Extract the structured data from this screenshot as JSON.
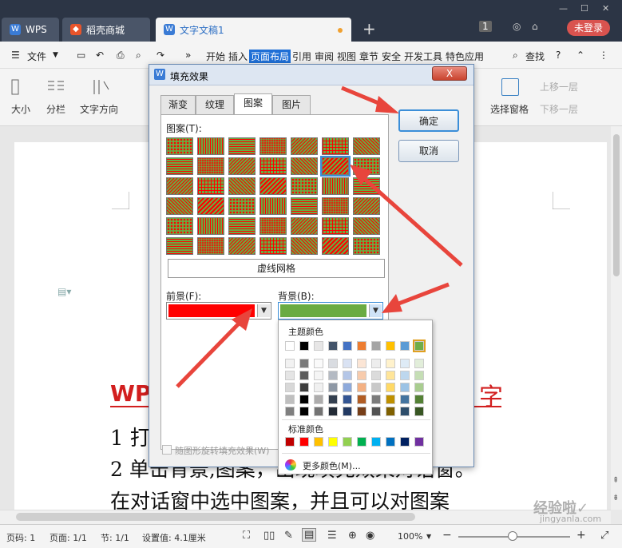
{
  "tabs": {
    "wps": "WPS",
    "store": "稻壳商城",
    "doc": "文字文稿1"
  },
  "titlebar": {
    "page_badge": "1",
    "login": "未登录"
  },
  "menu": {
    "file": "文件",
    "items": [
      "开始",
      "插入",
      "页面布局",
      "引用",
      "审阅",
      "视图",
      "章节",
      "安全",
      "开发工具",
      "特色应用"
    ],
    "active": "页面布局",
    "search": "查找",
    "help": "?"
  },
  "toolbar": {
    "size": "大小",
    "columns": "分栏",
    "text_dir": "文字方向",
    "select_pane": "选择窗格",
    "move_up": "上移一层",
    "move_down": "下移一层"
  },
  "document": {
    "heading_left": "WP",
    "heading_right": "字",
    "line1": "1 打",
    "line2": "2 单击背景,图案，出现填充效果对话窗。",
    "line3": "在对话窗中选中图案，并且可以对图案"
  },
  "dialog": {
    "title": "填充效果",
    "close": "X",
    "tabs": [
      "渐变",
      "纹理",
      "图案",
      "图片"
    ],
    "selected_tab": "图案",
    "pattern_label": "图案(T):",
    "dashed_grid": "虚线网格",
    "fg_label": "前景(F):",
    "bg_label": "背景(B):",
    "fg_color": "#ff0000",
    "bg_color": "#6aab42",
    "rotate_label": "随图形旋转填充效果(W)",
    "ok": "确定",
    "cancel": "取消"
  },
  "color_popup": {
    "theme_label": "主题颜色",
    "standard_label": "标准颜色",
    "more": "更多颜色(M)...",
    "theme_row": [
      "#ffffff",
      "#000000",
      "#e7e6e6",
      "#44546a",
      "#4472c4",
      "#ed7d31",
      "#a5a5a5",
      "#ffc000",
      "#5b9bd5",
      "#70ad47"
    ],
    "standard_row": [
      "#c00000",
      "#ff0000",
      "#ffc000",
      "#ffff00",
      "#92d050",
      "#00b050",
      "#00b0f0",
      "#0070c0",
      "#002060",
      "#7030a0"
    ]
  },
  "status": {
    "page": "页码: 1",
    "pages": "页面: 1/1",
    "section": "节: 1/1",
    "setting": "设置值: 4.1厘米",
    "zoom": "100%",
    "minus": "−",
    "plus": "+"
  },
  "watermark": "经验啦✓",
  "watermark_url": "jingyanla.com"
}
